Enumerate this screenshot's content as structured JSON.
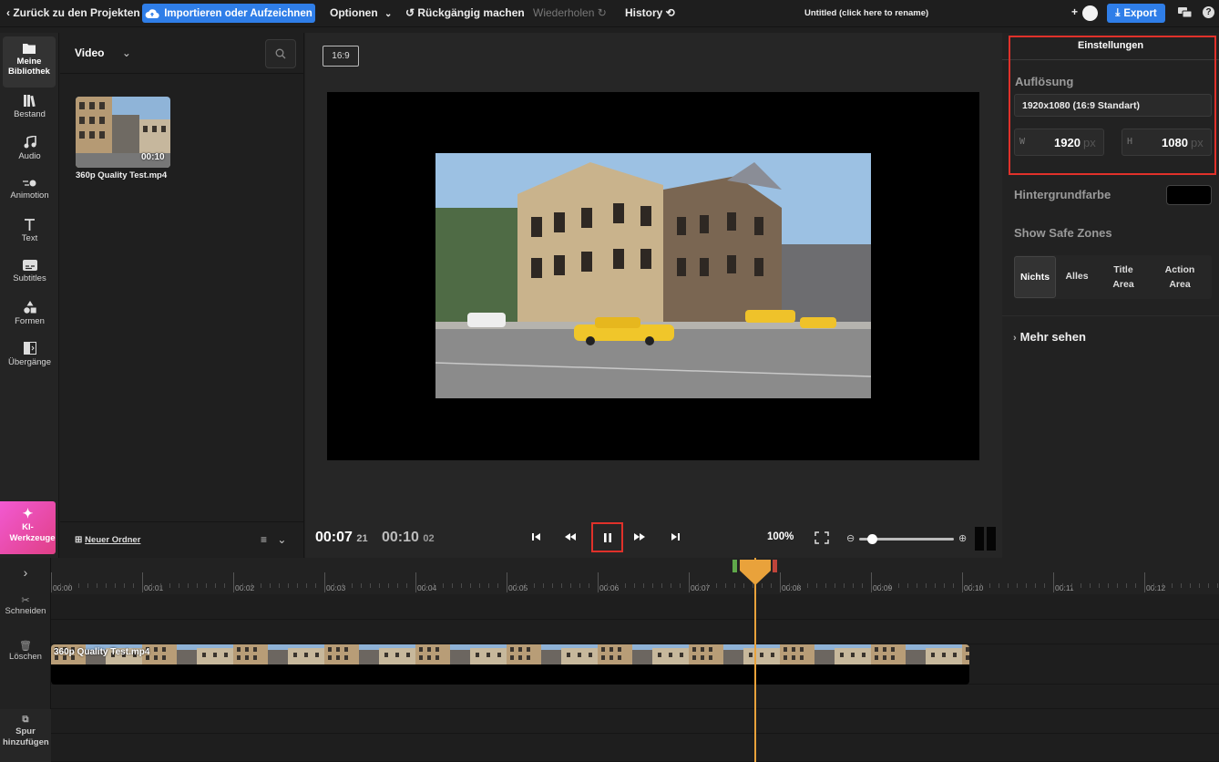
{
  "topbar": {
    "back_label": "Zurück zu den Projekten",
    "import_label": "Importieren oder Aufzeichnen",
    "options_label": "Optionen",
    "undo_label": "Rückgängig machen",
    "redo_label": "Wiederholen",
    "history_label": "History",
    "project_title": "Untitled (click here to rename)",
    "export_label": "Export",
    "add_symbol": "+",
    "help_symbol": "?"
  },
  "rail": {
    "items": [
      {
        "label": "Meine Bibliothek",
        "icon": "folder-icon"
      },
      {
        "label": "Bestand",
        "icon": "library-icon"
      },
      {
        "label": "Audio",
        "icon": "music-note-icon"
      },
      {
        "label": "Animotion",
        "icon": "animotion-icon"
      },
      {
        "label": "Text",
        "icon": "text-icon"
      },
      {
        "label": "Subtitles",
        "icon": "subtitles-icon"
      },
      {
        "label": "Formen",
        "icon": "shapes-icon"
      },
      {
        "label": "Übergänge",
        "icon": "transitions-icon"
      }
    ],
    "ki_label": "KI-Werkzeuge"
  },
  "library": {
    "filter_label": "Video",
    "media": [
      {
        "name": "360p Quality Test.mp4",
        "duration": "00:10"
      }
    ],
    "new_folder_label": "Neuer Ordner"
  },
  "stage": {
    "aspect_ratio": "16:9",
    "current_time": "00:07",
    "current_frame": "21",
    "total_time": "00:10",
    "total_frame": "02",
    "zoom": "100%",
    "zoom_level": 0.1
  },
  "settings": {
    "tab_label": "Einstellungen",
    "resolution_label": "Auflösung",
    "resolution_value": "1920x1080 (16:9 Standart)",
    "width_prefix": "W",
    "width_value": "1920",
    "height_prefix": "H",
    "height_value": "1080",
    "unit": "px",
    "bg_color_label": "Hintergrundfarbe",
    "bg_color": "#000000",
    "safe_zones_label": "Show Safe Zones",
    "safe_zone_options": [
      "Nichts",
      "Alles",
      "Title Area",
      "Action Area"
    ],
    "safe_zone_selected": "Nichts",
    "more_label": "Mehr sehen"
  },
  "timeline": {
    "ticks": [
      "00:00",
      "00:01",
      "00:02",
      "00:03",
      "00:04",
      "00:05",
      "00:06",
      "00:07",
      "00:08",
      "00:09",
      "00:10",
      "00:11",
      "00:12"
    ],
    "clip_name": "360p Quality Test.mp4",
    "cut_label": "Schneiden",
    "delete_label": "Löschen",
    "add_track_label": "Spur hinzufügen",
    "playhead_color": "#e9a23b"
  },
  "colors": {
    "accent": "#2f7ee8",
    "highlight": "#e0312a"
  }
}
